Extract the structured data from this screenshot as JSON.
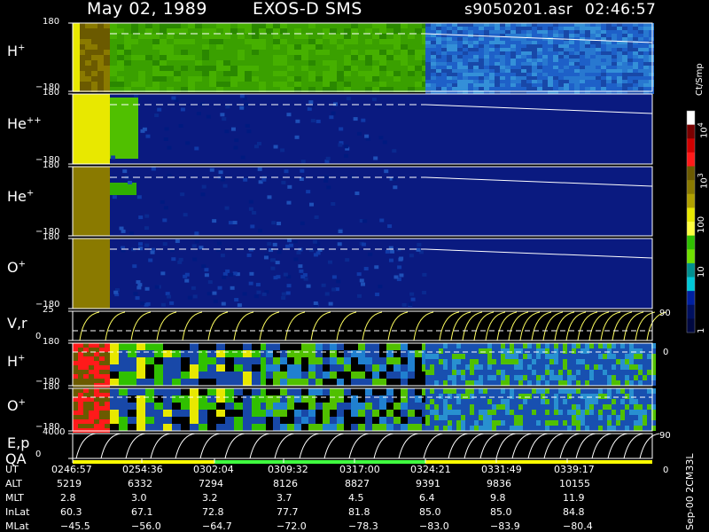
{
  "header": {
    "date": "May 02, 1989",
    "instrument": "EXOS-D SMS",
    "file": "s9050201.asr",
    "time": "02:46:57"
  },
  "panels": [
    {
      "id": "hplus",
      "label_base": "H",
      "label_sup": "+",
      "tick_top": "180",
      "tick_bottom": "−180"
    },
    {
      "id": "hepp",
      "label_base": "He",
      "label_sup": "++",
      "tick_top": "180",
      "tick_bottom": "−180"
    },
    {
      "id": "heplus",
      "label_base": "He",
      "label_sup": "+",
      "tick_top": "180",
      "tick_bottom": "−180"
    },
    {
      "id": "oplus",
      "label_base": "O",
      "label_sup": "+",
      "tick_top": "180",
      "tick_bottom": "−180"
    },
    {
      "id": "vr",
      "label_base": "V,r",
      "label_sup": "",
      "tick_top": "25",
      "tick_bottom": "0",
      "right_top": "90",
      "right_bottom": "0"
    },
    {
      "id": "hplus2",
      "label_base": "H",
      "label_sup": "+",
      "tick_top": "180",
      "tick_bottom": "−180"
    },
    {
      "id": "oplus2",
      "label_base": "O",
      "label_sup": "+",
      "tick_top": "180",
      "tick_bottom": "−180"
    },
    {
      "id": "ep",
      "label_base": "E,p",
      "label_sup": "",
      "tick_top": "4000",
      "tick_bottom": "0",
      "right_top": "90",
      "right_bottom": "0"
    }
  ],
  "qa_label": "QA",
  "colorbar": {
    "unit": "Ct/Smp",
    "ticks": [
      {
        "base": "10",
        "sup": "4"
      },
      {
        "base": "10",
        "sup": "3"
      },
      {
        "base": "100",
        "sup": ""
      },
      {
        "base": "10",
        "sup": ""
      },
      {
        "base": "1",
        "sup": ""
      }
    ],
    "colors": [
      "#ffffff",
      "#7a0000",
      "#d00000",
      "#ff1a1a",
      "#6b5a00",
      "#8a7a00",
      "#b0a000",
      "#e8e800",
      "#ffff40",
      "#30c000",
      "#70e000",
      "#009090",
      "#00c8d8",
      "#0020a0",
      "#001060",
      "#000840"
    ]
  },
  "footer_note": "Sep-00 2CM33L",
  "ephemeris": {
    "row_labels": [
      "UT",
      "ALT",
      "MLT",
      "InLat",
      "MLat"
    ],
    "columns": [
      {
        "UT": "0246:57",
        "ALT": "5219",
        "MLT": "2.8",
        "InLat": "60.3",
        "MLat": "−45.5"
      },
      {
        "UT": "0254:36",
        "ALT": "6332",
        "MLT": "3.0",
        "InLat": "67.1",
        "MLat": "−56.0"
      },
      {
        "UT": "0302:04",
        "ALT": "7294",
        "MLT": "3.2",
        "InLat": "72.8",
        "MLat": "−64.7"
      },
      {
        "UT": "0309:32",
        "ALT": "8126",
        "MLT": "3.7",
        "InLat": "77.7",
        "MLat": "−72.0"
      },
      {
        "UT": "0317:00",
        "ALT": "8827",
        "MLT": "4.5",
        "InLat": "81.8",
        "MLat": "−78.3"
      },
      {
        "UT": "0324:21",
        "ALT": "9391",
        "MLT": "6.4",
        "InLat": "85.0",
        "MLat": "−83.0"
      },
      {
        "UT": "0331:49",
        "ALT": "9836",
        "MLT": "9.8",
        "InLat": "85.0",
        "MLat": "−83.9"
      },
      {
        "UT": "0339:17",
        "ALT": "10155",
        "MLT": "11.9",
        "InLat": "84.8",
        "MLat": "−80.4"
      }
    ]
  },
  "chart_data": {
    "type": "heatmap",
    "title": "May 02, 1989   EXOS-D SMS",
    "x_axis": "UT",
    "x_ticks": [
      "0246:57",
      "0254:36",
      "0302:04",
      "0309:32",
      "0317:00",
      "0324:21",
      "0331:49",
      "0339:17"
    ],
    "color_scale": "log",
    "color_range": [
      1,
      10000
    ],
    "color_unit": "Ct/Smp",
    "panels": [
      {
        "name": "H+",
        "y_range": [
          -180,
          180
        ]
      },
      {
        "name": "He++",
        "y_range": [
          -180,
          180
        ]
      },
      {
        "name": "He+",
        "y_range": [
          -180,
          180
        ]
      },
      {
        "name": "O+",
        "y_range": [
          -180,
          180
        ]
      },
      {
        "name": "V,r",
        "y_range": [
          0,
          25
        ],
        "right_range": [
          0,
          90
        ]
      },
      {
        "name": "H+",
        "y_range": [
          -180,
          180
        ]
      },
      {
        "name": "O+",
        "y_range": [
          -180,
          180
        ]
      },
      {
        "name": "E,p",
        "y_range": [
          0,
          4000
        ],
        "right_range": [
          0,
          90
        ]
      }
    ]
  }
}
